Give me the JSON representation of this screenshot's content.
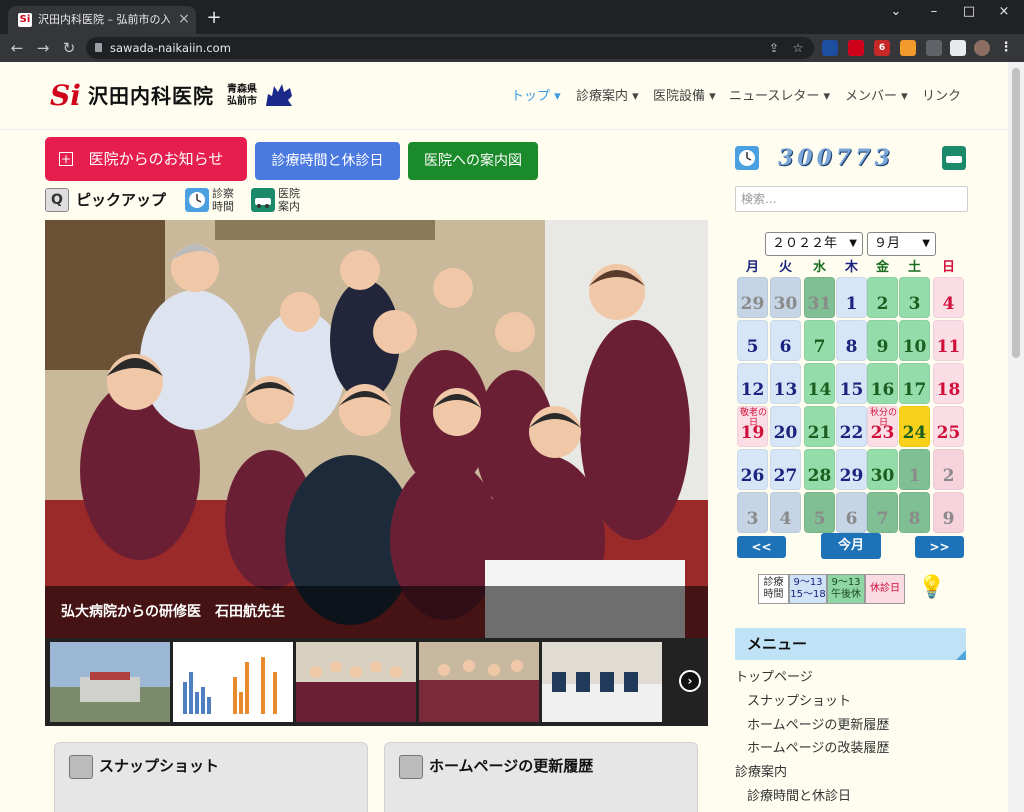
{
  "browser": {
    "tab_title": "沢田内科医院 – 弘前市の入院設備",
    "url": "sawada-naikaiin.com",
    "tab_close": "×",
    "new_tab": "+",
    "win_min": "–",
    "win_max": "□",
    "win_close": "×",
    "win_chevron": "⌄",
    "back": "←",
    "forward": "→",
    "reload": "↻",
    "share": "⇪",
    "bookmark": "☆",
    "ext_badge": "6"
  },
  "site": {
    "logo_mark": "Si",
    "logo_text": "沢田内科医院",
    "logo_pref_1": "青森県",
    "logo_pref_2": "弘前市"
  },
  "nav": [
    "トップ ▾",
    "診療案内 ▾",
    "医院設備 ▾",
    "ニュースレター ▾",
    "メンバー ▾",
    "リンク"
  ],
  "buttons": {
    "notice": "医院からのお知らせ",
    "notice_icon": "+",
    "hours": "診療時間と休診日",
    "map": "医院への案内図"
  },
  "pickup": {
    "label": "ピックアップ",
    "hours_1": "診察",
    "hours_2": "時間",
    "guide_1": "医院",
    "guide_2": "案内"
  },
  "slide": {
    "caption": "弘大病院からの研修医　石田航先生",
    "next": "›"
  },
  "cards": {
    "snapshot": "スナップショット",
    "history": "ホームページの更新履歴"
  },
  "sidebar": {
    "counter": "300773",
    "search_placeholder": "検索...",
    "year": "２０２２年",
    "month": "９月",
    "weekdays": [
      "月",
      "火",
      "水",
      "木",
      "金",
      "土",
      "日"
    ],
    "calendar": [
      [
        "29",
        "30",
        "31",
        "1",
        "2",
        "3",
        "4"
      ],
      [
        "5",
        "6",
        "7",
        "8",
        "9",
        "10",
        "11"
      ],
      [
        "12",
        "13",
        "14",
        "15",
        "16",
        "17",
        "18"
      ],
      [
        "19",
        "20",
        "21",
        "22",
        "23",
        "24",
        "25"
      ],
      [
        "26",
        "27",
        "28",
        "29",
        "30",
        "1",
        "2"
      ],
      [
        "3",
        "4",
        "5",
        "6",
        "7",
        "8",
        "9"
      ]
    ],
    "notes": {
      "r3c0": "敬老の日",
      "r3c4": "秋分の日"
    },
    "prev": "<<",
    "today": "今月",
    "next": ">>",
    "legend": {
      "label_1": "診療",
      "label_2": "時間",
      "am": "9～13",
      "pm": "15～18",
      "half_1": "9～13",
      "half_2": "午後休",
      "closed": "休診日"
    },
    "bulb": "💡",
    "menu_title": "メニュー",
    "menu": [
      "トップページ",
      "スナップショット",
      "ホームページの更新履歴",
      "ホームページの改装履歴",
      "診療案内",
      "診療時間と休診日"
    ]
  }
}
